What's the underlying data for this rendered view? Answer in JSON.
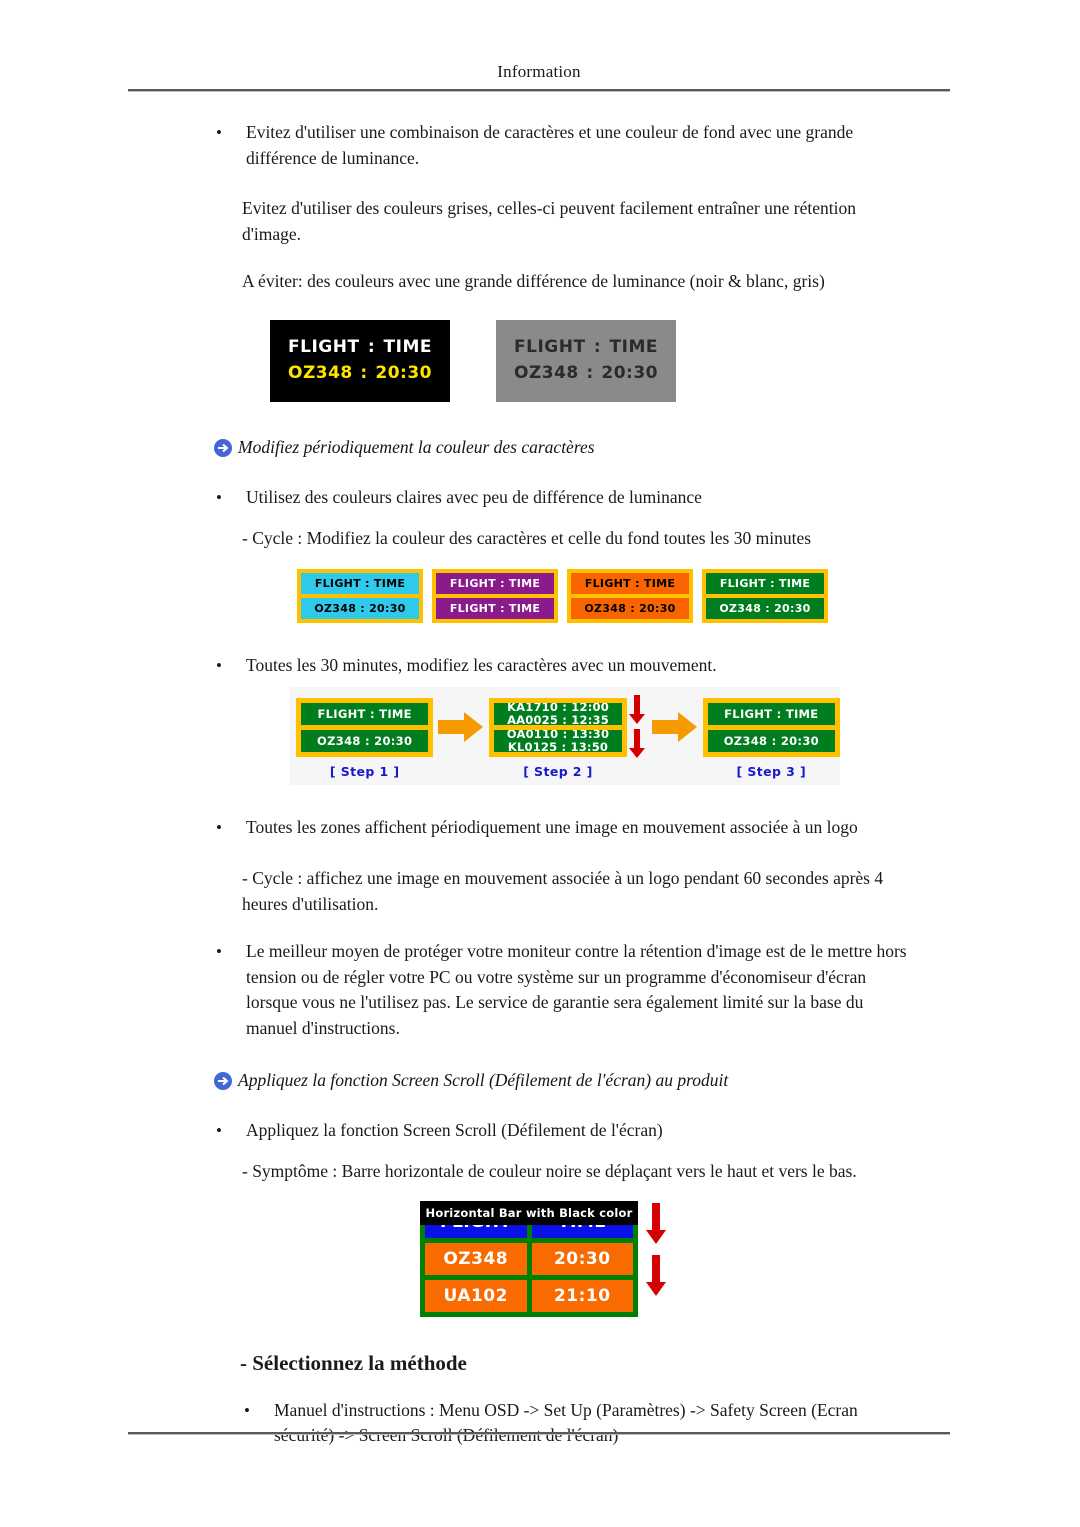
{
  "header": {
    "title": "Information"
  },
  "body": {
    "b1": "Evitez d'utiliser une combinaison de caractères et une couleur de fond avec une grande différence de luminance.",
    "p1": "Evitez d'utiliser des couleurs grises, celles-ci peuvent facilement entraîner une rétention d'image.",
    "p2": "A éviter: des couleurs avec une grande différence de luminance (noir & blanc, gris)",
    "section1_heading": "Modifiez périodiquement la couleur des caractères",
    "b2": "Utilisez des couleurs claires avec peu de différence de luminance",
    "p3": "- Cycle : Modifiez la couleur des caractères et celle du fond toutes les 30 minutes",
    "b3": "Toutes les 30 minutes, modifiez les caractères avec un mouvement.",
    "b4": "Toutes les zones affichent périodiquement une image en mouvement associée à un logo",
    "p4": "- Cycle : affichez une image en mouvement associée à un logo pendant 60 secondes après 4 heures d'utilisation.",
    "b5": "Le meilleur moyen de protéger votre moniteur contre la rétention d'image est de le mettre hors tension ou de régler votre PC ou votre système sur un programme d'économiseur d'écran lorsque vous ne l'utilisez pas. Le service de garantie sera également limité sur la base du manuel d'instructions.",
    "section2_heading": "Appliquez la fonction Screen Scroll (Défilement de l'écran) au produit",
    "b6": "Appliquez la fonction Screen Scroll (Défilement de l'écran)",
    "p5": "- Symptôme : Barre horizontale de couleur noire se déplaçant vers le haut et vers le bas.",
    "method_heading": "- Sélectionnez la méthode",
    "b7": "Manuel d'instructions : Menu OSD -> Set Up (Paramètres) -> Safety Screen (Ecran sécurité) -> Screen Scroll (Défilement de l'écran)",
    "bullet_char": "•"
  },
  "figure_contrast": {
    "panels": [
      {
        "name": "black-panel",
        "bg": "#000000",
        "head_color": "#ffffff",
        "data_color": "#ffe400",
        "head_left": "FLIGHT",
        "head_colon": ":",
        "head_right": "TIME",
        "data_left": "OZ348",
        "data_colon": ":",
        "data_right": "20:30"
      },
      {
        "name": "gray-panel",
        "bg": "#8a8a8a",
        "head_color": "#2b2b2b",
        "data_color": "#2b2b2b",
        "head_left": "FLIGHT",
        "head_colon": ":",
        "head_right": "TIME",
        "data_left": "OZ348",
        "data_colon": ":",
        "data_right": "20:30"
      }
    ]
  },
  "figure_colorcycle": {
    "border_color": "#ffc000",
    "panels": [
      {
        "name": "cyan-panel",
        "bg": "#2fc9ec",
        "fg": "#000000",
        "line1": "FLIGHT  :  TIME",
        "line2": "OZ348    :  20:30"
      },
      {
        "name": "purple-panel",
        "bg": "#8b1a8b",
        "fg": "#ffffff",
        "line1": "FLIGHT  :  TIME",
        "line2": "FLIGHT  :  TIME"
      },
      {
        "name": "orange-panel",
        "bg": "#fa6400",
        "fg": "#000000",
        "line1": "FLIGHT  :  TIME",
        "line2": "OZ348    :  20:30"
      },
      {
        "name": "green-panel",
        "bg": "#007d1e",
        "fg": "#ffffff",
        "line1": "FLIGHT  :  TIME",
        "line2": "OZ348    :  20:30"
      }
    ]
  },
  "figure_steps": {
    "step1": {
      "label": "[ Step 1 ]",
      "line1": "FLIGHT  :  TIME",
      "line2": "OZ348    :  20:30"
    },
    "step2": {
      "label": "[ Step 2 ]",
      "cell1_top": "KA1710  :  12:00",
      "cell1_bottom": "AA0025  :  12:35",
      "cell2_top": "OA0110  :  13:30",
      "cell2_bottom": "KL0125  :  13:50"
    },
    "step3": {
      "label": "[ Step 3 ]",
      "line1": "FLIGHT  :  TIME",
      "line2": "OZ348    :  20:30"
    },
    "arrow_color": "#f59a00",
    "scroll_arrow_color": "#d40000",
    "label_color": "#1919cc"
  },
  "figure_blackbar": {
    "bar_label": "Horizontal Bar with Black color",
    "screen_border": "#008000",
    "rows": [
      {
        "name": "header-row",
        "bg": "#0a12e8",
        "left": "FLIGHT",
        "right": "TIME"
      },
      {
        "name": "flight-row-1",
        "bg": "#f96a00",
        "left": "OZ348",
        "right": "20:30"
      },
      {
        "name": "flight-row-2",
        "bg": "#f96a00",
        "left": "UA102",
        "right": "21:10"
      }
    ],
    "arrow_color": "#d40000"
  }
}
